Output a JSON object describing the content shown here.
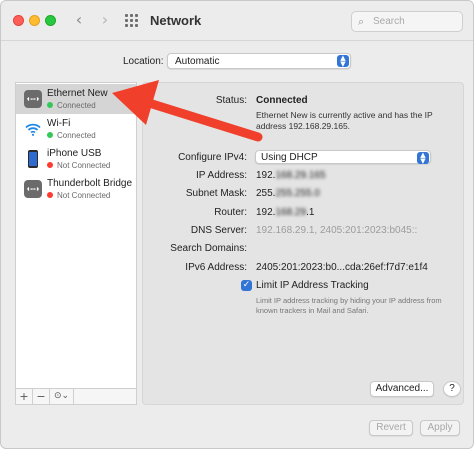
{
  "window": {
    "title": "Network",
    "search_placeholder": "Search"
  },
  "location": {
    "label": "Location:",
    "value": "Automatic"
  },
  "services": [
    {
      "name": "Ethernet New",
      "status": "Connected",
      "status_color": "#34c759",
      "icon": "ethernet-icon",
      "selected": true
    },
    {
      "name": "Wi-Fi",
      "status": "Connected",
      "status_color": "#34c759",
      "icon": "wifi-icon",
      "selected": false
    },
    {
      "name": "iPhone USB",
      "status": "Not Connected",
      "status_color": "#ff3b30",
      "icon": "iphone-icon",
      "selected": false
    },
    {
      "name": "Thunderbolt Bridge",
      "status": "Not Connected",
      "status_color": "#ff3b30",
      "icon": "thunderbolt-bridge-icon",
      "selected": false
    }
  ],
  "list_footer": {
    "add": "+",
    "remove": "−",
    "actions": "⊙⌄"
  },
  "detail": {
    "status_label": "Status:",
    "status_value": "Connected",
    "status_desc": "Ethernet New is currently active and has the IP address 192.168.29.165.",
    "configure_label": "Configure IPv4:",
    "configure_value": "Using DHCP",
    "ip_label": "IP Address:",
    "ip_value": "192.",
    "ip_blur": "168.29.165",
    "subnet_label": "Subnet Mask:",
    "subnet_value": "255.",
    "subnet_blur": "255.255.0",
    "router_label": "Router:",
    "router_value": "192.",
    "router_blur": "168.29",
    "router_suffix": ".1",
    "dns_label": "DNS Server:",
    "dns_value": "192.168.29.1, 2405:201:2023:b045::",
    "search_domains_label": "Search Domains:",
    "ipv6_label": "IPv6 Address:",
    "ipv6_value": "2405:201:2023:b0...cda:26ef:f7d7:e1f4",
    "limit_label": "Limit IP Address Tracking",
    "limit_desc": "Limit IP address tracking by hiding your IP address from known trackers in Mail and Safari.",
    "advanced_button": "Advanced...",
    "help_button": "?"
  },
  "footer": {
    "revert": "Revert",
    "apply": "Apply"
  },
  "annotation_color": "#f0402c"
}
